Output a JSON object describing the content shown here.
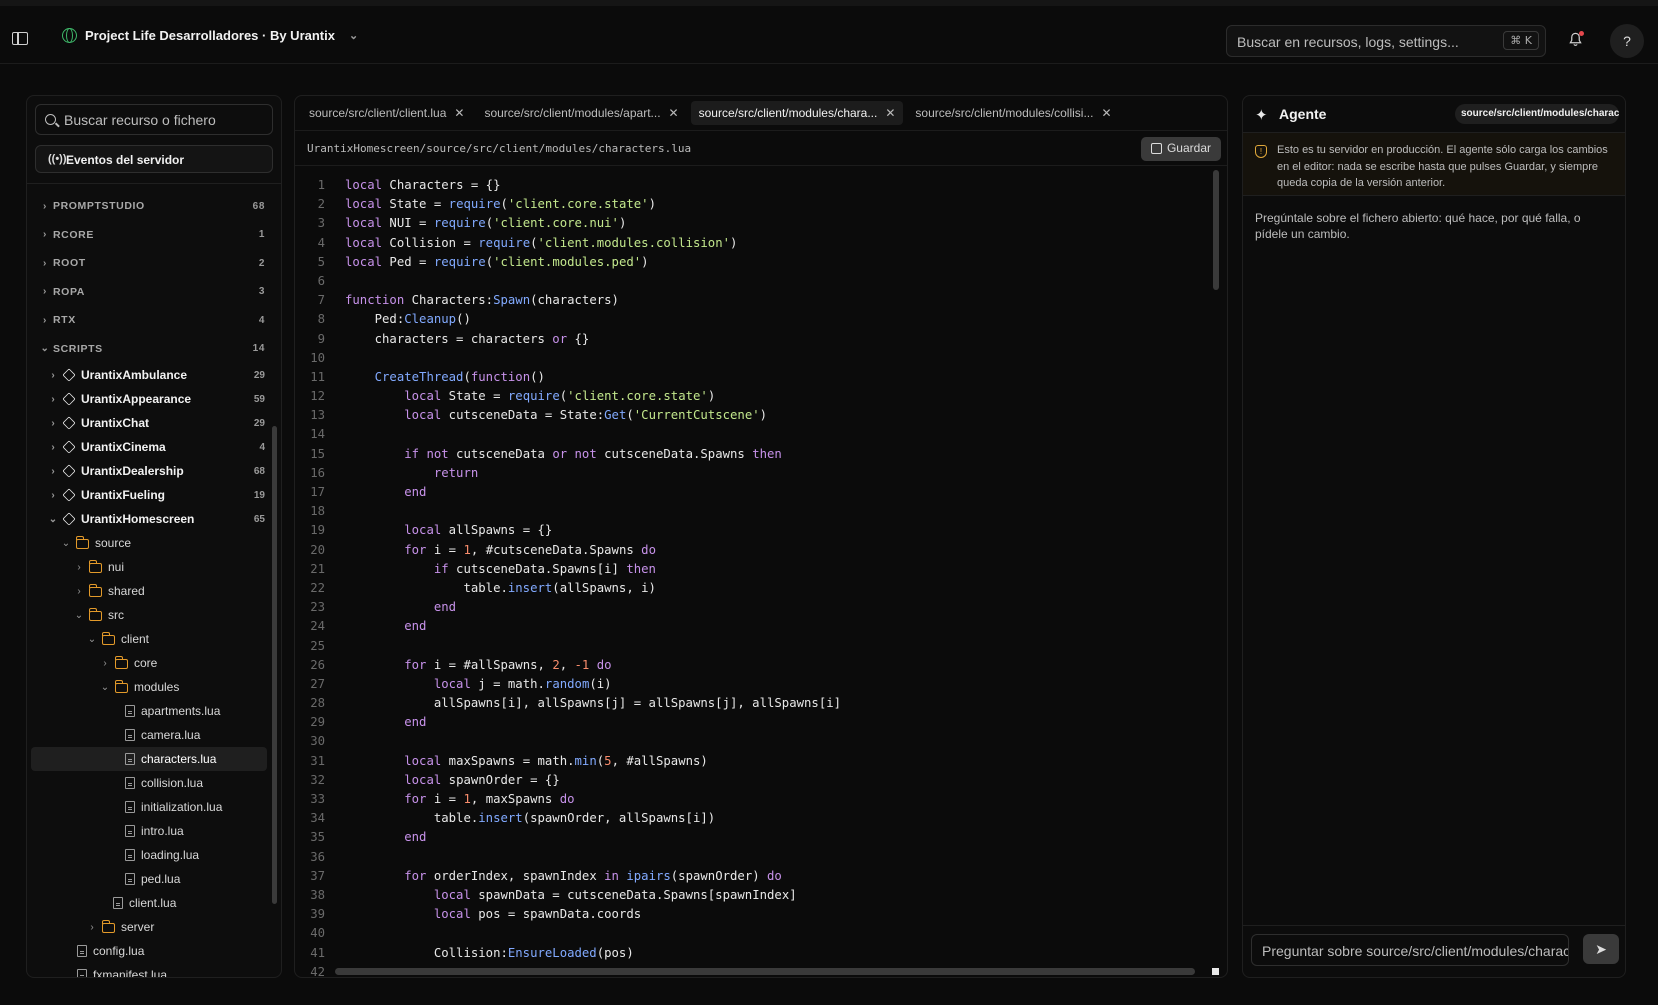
{
  "topbar": {
    "project_name": "Project Life Desarrolladores · By Urantix",
    "search_placeholder": "Buscar en recursos, logs, settings...",
    "shortcut": "⌘ K",
    "help": "?"
  },
  "sidebar": {
    "search_placeholder": "Buscar recurso o fichero",
    "events_label": "Eventos del servidor",
    "groups": [
      {
        "label": "PROMPTSTUDIO",
        "count": "68"
      },
      {
        "label": "RCORE",
        "count": "1"
      },
      {
        "label": "ROOT",
        "count": "2"
      },
      {
        "label": "ROPA",
        "count": "3"
      },
      {
        "label": "RTX",
        "count": "4"
      },
      {
        "label": "SCRIPTS",
        "count": "14"
      }
    ],
    "resources": [
      {
        "label": "UrantixAmbulance",
        "count": "29"
      },
      {
        "label": "UrantixAppearance",
        "count": "59"
      },
      {
        "label": "UrantixChat",
        "count": "29"
      },
      {
        "label": "UrantixCinema",
        "count": "4"
      },
      {
        "label": "UrantixDealership",
        "count": "68"
      },
      {
        "label": "UrantixFueling",
        "count": "19"
      },
      {
        "label": "UrantixHomescreen",
        "count": "65"
      }
    ],
    "tree": {
      "source": "source",
      "nui": "nui",
      "shared": "shared",
      "src": "src",
      "client": "client",
      "core": "core",
      "modules": "modules",
      "files": [
        "apartments.lua",
        "camera.lua",
        "characters.lua",
        "collision.lua",
        "initialization.lua",
        "intro.lua",
        "loading.lua",
        "ped.lua"
      ],
      "client_lua": "client.lua",
      "server": "server",
      "config": "config.lua",
      "fxmanifest": "fxmanifest.lua"
    }
  },
  "editor": {
    "tabs": [
      {
        "label": "source/src/client/client.lua"
      },
      {
        "label": "source/src/client/modules/apart..."
      },
      {
        "label": "source/src/client/modules/chara..."
      },
      {
        "label": "source/src/client/modules/collisi..."
      }
    ],
    "path": "UrantixHomescreen/source/src/client/modules/characters.lua",
    "save_label": "Guardar"
  },
  "agent": {
    "title": "Agente",
    "context_pill": "source/src/client/modules/characters.lua",
    "warning": "Esto es tu servidor en producción. El agente sólo carga los cambios en el editor: nada se escribe hasta que pulses Guardar, y siempre queda copia de la versión anterior.",
    "hint": "Pregúntale sobre el fichero abierto: qué hace, por qué falla, o pídele un cambio.",
    "input_placeholder": "Preguntar sobre source/src/client/modules/characters.lua"
  },
  "colors": {
    "keyword": "#c792ea",
    "function": "#82aaff",
    "string": "#c3e88d",
    "number": "#f78c6c",
    "folder": "#e39a2a",
    "warning": "#e0a83a"
  }
}
